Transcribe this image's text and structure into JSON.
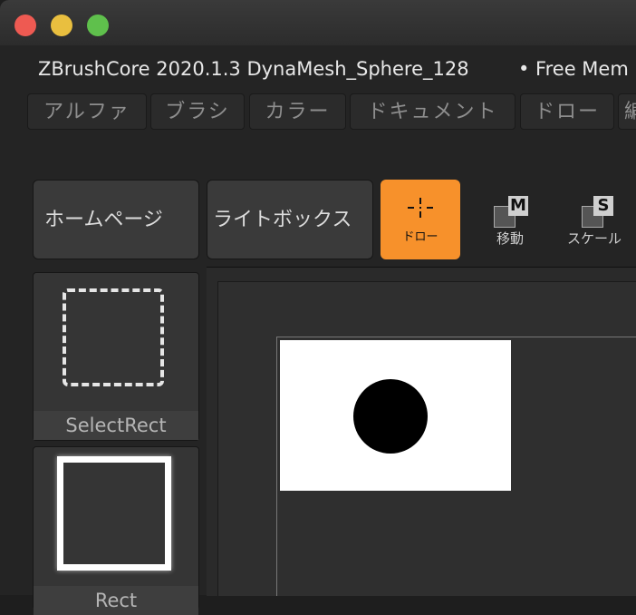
{
  "window": {
    "title_info": "ZBrushCore 2020.1.3 DynaMesh_Sphere_128",
    "memory": "• Free Mem"
  },
  "menu": [
    "アルファ",
    "ブラシ",
    "カラー",
    "ドキュメント",
    "ドロー",
    "編"
  ],
  "toolbar": {
    "home": "ホームページ",
    "lightbox": "ライトボックス",
    "draw": "ドロー",
    "move": "移動",
    "move_key": "M",
    "scale": "スケール",
    "scale_key": "S"
  },
  "alpha_panel": [
    {
      "label": "SelectRect"
    },
    {
      "label": "Rect"
    }
  ],
  "colors": {
    "accent": "#f7912b"
  }
}
